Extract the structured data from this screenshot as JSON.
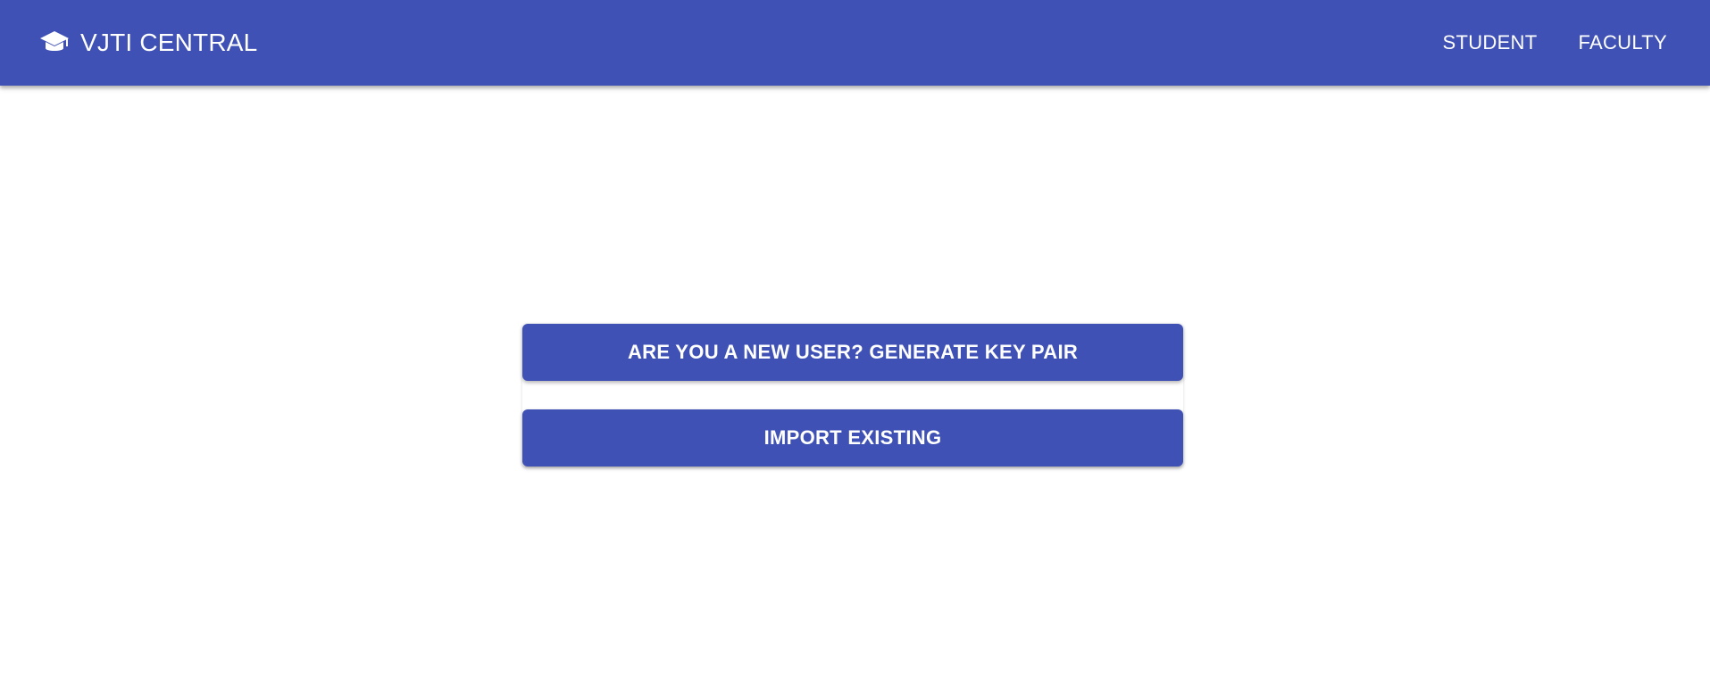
{
  "header": {
    "brand_icon": "graduation-cap-icon",
    "title": "VJTI CENTRAL",
    "nav": [
      {
        "label": "STUDENT"
      },
      {
        "label": "FACULTY"
      }
    ]
  },
  "main": {
    "generate_button_label": "ARE YOU A NEW USER? GENERATE KEY PAIR",
    "import_button_label": "IMPORT EXISTING"
  },
  "colors": {
    "primary": "#3f51b5",
    "on_primary": "#ffffff",
    "background": "#ffffff"
  }
}
